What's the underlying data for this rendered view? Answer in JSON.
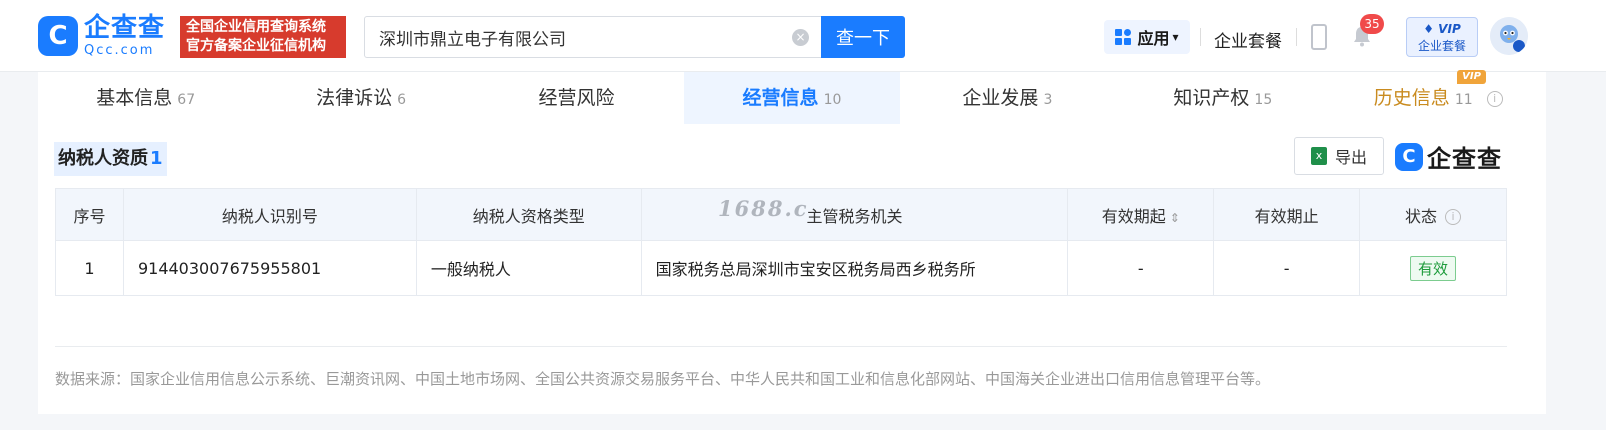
{
  "header": {
    "logo_mark": "C",
    "logo_name": "企查查",
    "logo_domain": "Qcc.com",
    "badge_line1": "全国企业信用查询系统",
    "badge_line2": "官方备案企业征信机构",
    "search_value": "深圳市鼎立电子有限公司",
    "search_clear": "×",
    "search_button": "查一下",
    "apps_label": "应用",
    "apps_caret": "▾",
    "package_label": "企业套餐",
    "notification_count": "35",
    "vip_top": "♦ VIP",
    "vip_bottom": "企业套餐"
  },
  "tabs": [
    {
      "label": "基本信息",
      "count": "67"
    },
    {
      "label": "法律诉讼",
      "count": "6"
    },
    {
      "label": "经营风险",
      "count": ""
    },
    {
      "label": "经营信息",
      "count": "10"
    },
    {
      "label": "企业发展",
      "count": "3"
    },
    {
      "label": "知识产权",
      "count": "15"
    },
    {
      "label": "历史信息",
      "count": "11",
      "tag": "VIP"
    }
  ],
  "section": {
    "title": "纳税人资质",
    "count": "1",
    "export_label": "导出",
    "brand_mark": "C",
    "brand_name": "企查查"
  },
  "table": {
    "headers": [
      "序号",
      "纳税人识别号",
      "纳税人资格类型",
      "主管税务机关",
      "有效期起",
      "有效期止",
      "状态"
    ],
    "rows": [
      [
        "1",
        "914403007675955801",
        "一般纳税人",
        "国家税务总局深圳市宝安区税务局西乡税务所",
        "-",
        "-",
        "有效"
      ]
    ]
  },
  "watermark": "1688.c",
  "footer": {
    "source": "数据来源：国家企业信用信息公示系统、巨潮资讯网、中国土地市场网、全国公共资源交易服务平台、中华人民共和国工业和信息化部网站、中国海关企业进出口信用信息管理平台等。"
  },
  "colors": {
    "primary": "#1a7cff",
    "badge_red": "#d73b2d",
    "status_green": "#1d9b3b",
    "history_gold": "#c98b1f"
  }
}
